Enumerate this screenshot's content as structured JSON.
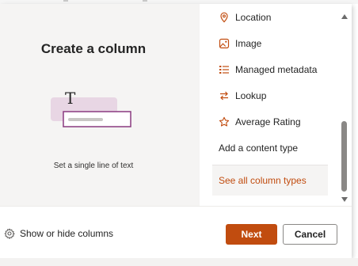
{
  "preview": {
    "title": "Create a column",
    "caption": "Set a single line of text",
    "cursor_glyph": "T"
  },
  "column_types": [
    {
      "label": "Location",
      "icon": "location-pin-icon"
    },
    {
      "label": "Image",
      "icon": "image-icon"
    },
    {
      "label": "Managed metadata",
      "icon": "managed-metadata-icon"
    },
    {
      "label": "Lookup",
      "icon": "lookup-arrows-icon"
    },
    {
      "label": "Average Rating",
      "icon": "star-icon"
    },
    {
      "label": "Add a content type",
      "icon": ""
    }
  ],
  "see_all_label": "See all column types",
  "footer": {
    "show_hide_label": "Show or hide columns",
    "next_label": "Next",
    "cancel_label": "Cancel"
  },
  "colors": {
    "accent": "#c14c0f",
    "pane_background": "#f5f4f3",
    "illustration_fill": "#e8d6e4",
    "illustration_border": "#8a3a80"
  }
}
